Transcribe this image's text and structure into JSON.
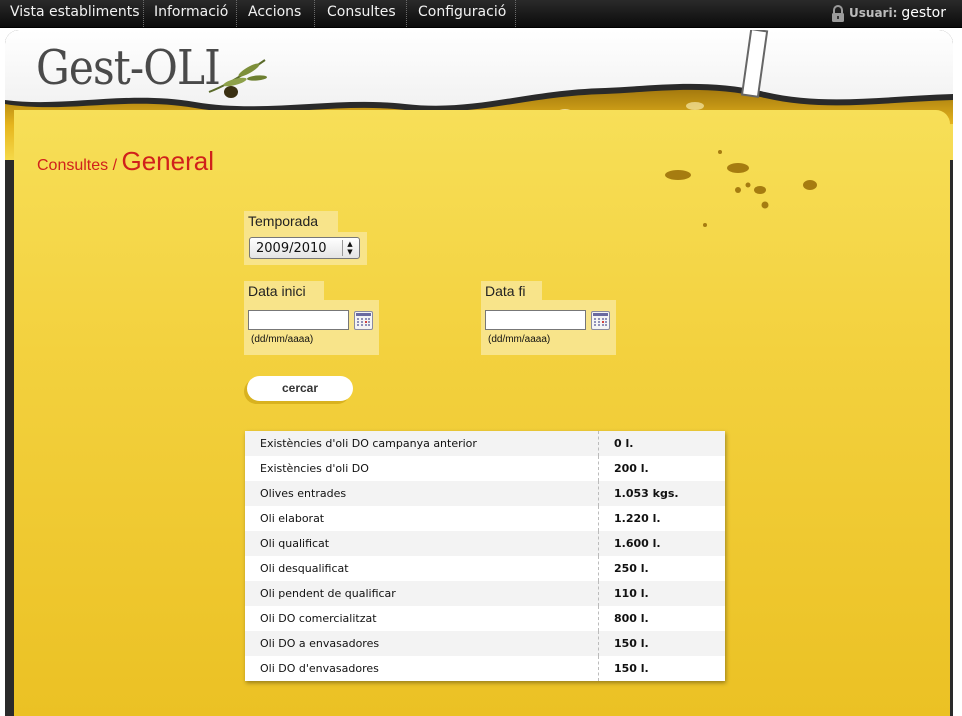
{
  "nav": {
    "items": [
      "Vista establiments",
      "Informació",
      "Accions",
      "Consultes",
      "Configuració"
    ]
  },
  "user": {
    "label": "Usuari:",
    "name": "gestor"
  },
  "brand": {
    "logo_text": "Gest-OLI"
  },
  "breadcrumb": {
    "parent": "Consultes /",
    "current": "General"
  },
  "form": {
    "season_label": "Temporada",
    "season_value": "2009/2010",
    "start_label": "Data inici",
    "end_label": "Data fi",
    "start_value": "",
    "end_value": "",
    "date_hint": "(dd/mm/aaaa)",
    "search_button": "cercar"
  },
  "results": [
    {
      "name": "Existències d'oli DO campanya anterior",
      "value": "0 l."
    },
    {
      "name": "Existències d'oli DO",
      "value": "200 l."
    },
    {
      "name": "Olives entrades",
      "value": "1.053 kgs."
    },
    {
      "name": "Oli elaborat",
      "value": "1.220 l."
    },
    {
      "name": "Oli qualificat",
      "value": "1.600 l."
    },
    {
      "name": "Oli desqualificat",
      "value": "250 l."
    },
    {
      "name": "Oli pendent de qualificar",
      "value": "110 l."
    },
    {
      "name": "Oli DO comercialitzat",
      "value": "800 l."
    },
    {
      "name": "Oli DO a envasadores",
      "value": "150 l."
    },
    {
      "name": "Oli DO d'envasadores",
      "value": "150 l."
    }
  ],
  "colors": {
    "accent": "#d0211b",
    "oil": "#f3d13e",
    "bar": "#1a1a1a"
  },
  "icons": [
    "lock-icon",
    "calendar-icon",
    "olive-branch-icon"
  ]
}
